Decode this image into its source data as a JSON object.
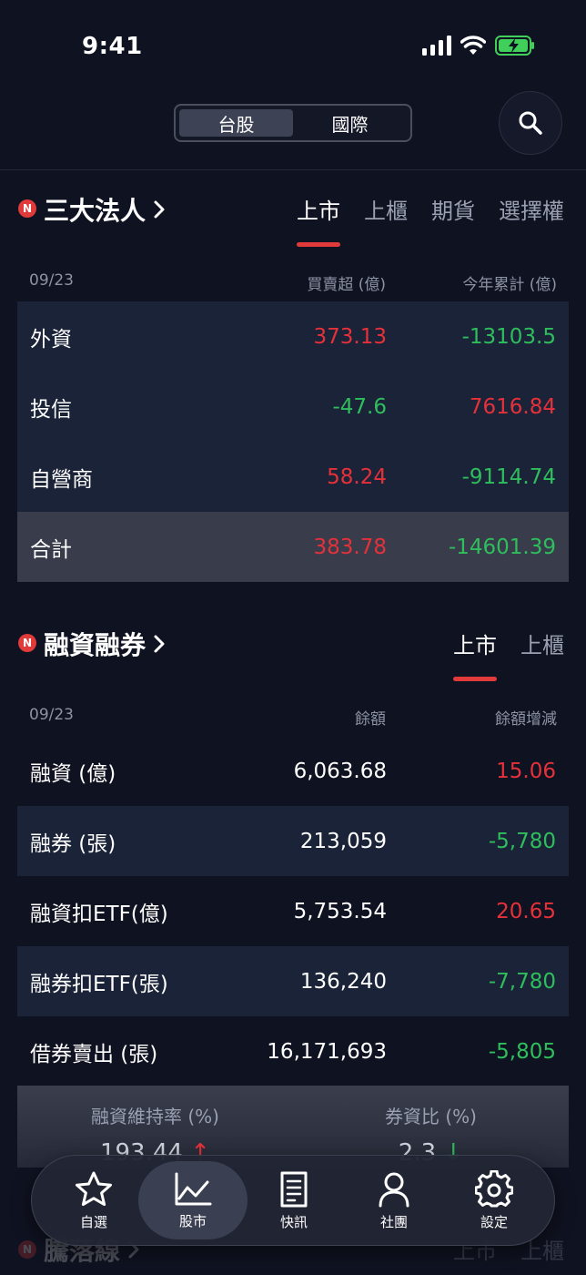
{
  "status": {
    "time": "9:41"
  },
  "header": {
    "segments": [
      "台股",
      "國際"
    ],
    "active_segment": 0
  },
  "institutional": {
    "title": "三大法人",
    "badge": "N",
    "tabs": [
      "上市",
      "上櫃",
      "期貨",
      "選擇權"
    ],
    "active_tab": 0,
    "date": "09/23",
    "col_net": "買賣超 (億)",
    "col_ytd": "今年累計 (億)",
    "rows": [
      {
        "name": "外資",
        "net": "373.13",
        "ytd": "-13103.5"
      },
      {
        "name": "投信",
        "net": "-47.6",
        "ytd": "7616.84"
      },
      {
        "name": "自營商",
        "net": "58.24",
        "ytd": "-9114.74"
      },
      {
        "name": "合計",
        "net": "383.78",
        "ytd": "-14601.39"
      }
    ]
  },
  "margin": {
    "title": "融資融券",
    "badge": "N",
    "tabs": [
      "上市",
      "上櫃"
    ],
    "active_tab": 0,
    "date": "09/23",
    "col_balance": "餘額",
    "col_change": "餘額增減",
    "rows": [
      {
        "name": "融資 (億)",
        "balance": "6,063.68",
        "change": "15.06"
      },
      {
        "name": "融券 (張)",
        "balance": "213,059",
        "change": "-5,780"
      },
      {
        "name": "融資扣ETF(億)",
        "balance": "5,753.54",
        "change": "20.65"
      },
      {
        "name": "融券扣ETF(張)",
        "balance": "136,240",
        "change": "-7,780"
      },
      {
        "name": "借券賣出 (張)",
        "balance": "16,171,693",
        "change": "-5,805"
      }
    ],
    "maintenance_label": "融資維持率 (%)",
    "maintenance_value": "193.44",
    "ratio_label": "券資比 (%)",
    "ratio_value": "2.3"
  },
  "next_section": {
    "title": "騰落線",
    "badge": "N",
    "tabs": [
      "上市",
      "上櫃"
    ]
  },
  "tabbar": {
    "items": [
      {
        "label": "自選",
        "icon": "star-icon"
      },
      {
        "label": "股市",
        "icon": "chart-line-icon"
      },
      {
        "label": "快訊",
        "icon": "news-document-icon"
      },
      {
        "label": "社團",
        "icon": "person-icon"
      },
      {
        "label": "設定",
        "icon": "gear-icon"
      }
    ],
    "active": 1
  },
  "colors": {
    "up": "#e5313a",
    "down": "#2fbe5c",
    "accent": "#e03a3a"
  }
}
